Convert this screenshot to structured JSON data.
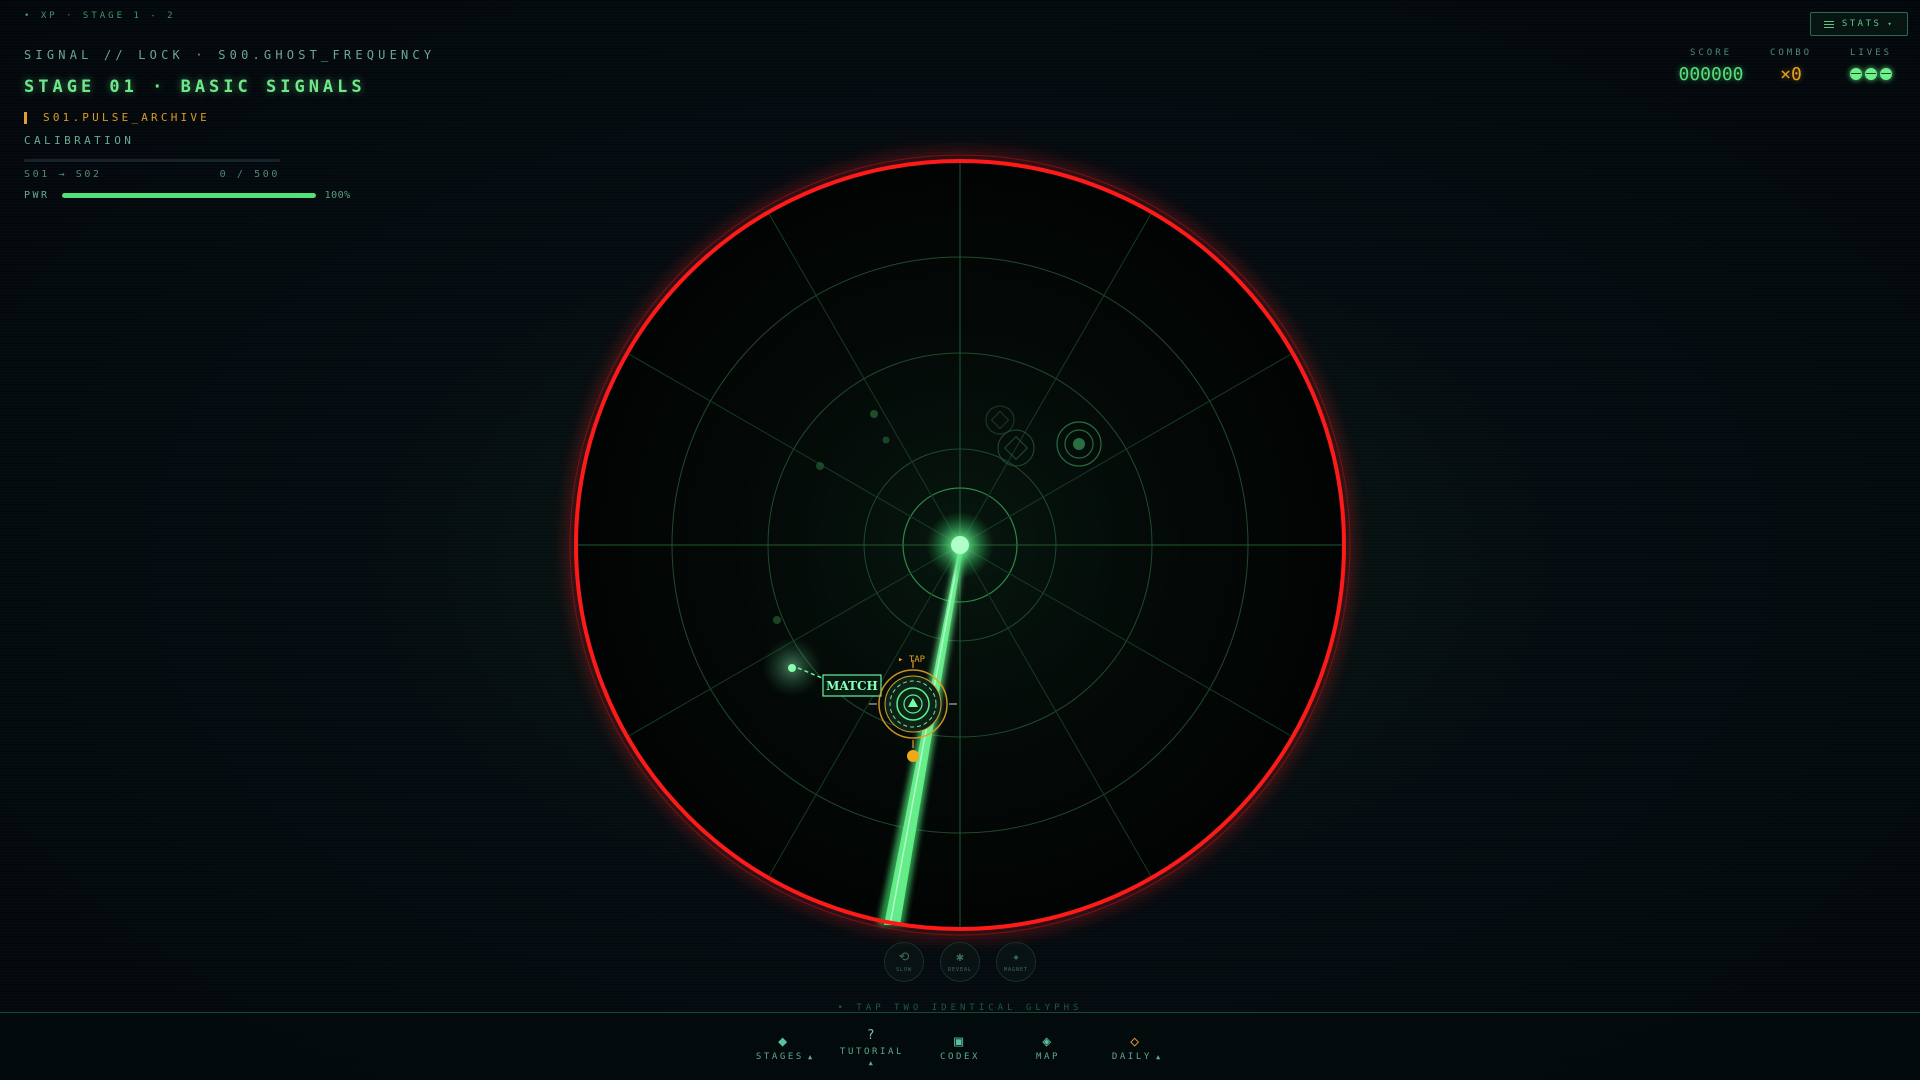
{
  "top_tag": "• XP · STAGE 1 - 2",
  "hud": {
    "signal_line": "SIGNAL // LOCK · S00.GHOST_FREQUENCY",
    "stage_title": "STAGE 01 · BASIC SIGNALS",
    "archive": "S01.PULSE_ARCHIVE",
    "calibration_label": "CALIBRATION",
    "calibration_route": "S01 → S02",
    "calibration_progress": "0 / 500",
    "calibration_fraction": 0.0,
    "pwr_label": "PWR",
    "pwr_percent_text": "100%",
    "pwr_fraction": 1.0
  },
  "stats_button": {
    "label": "STATS",
    "caret": "▾"
  },
  "scoreboard": {
    "score_label": "SCORE",
    "score_value": "000000",
    "combo_label": "COMBO",
    "combo_value": "×0",
    "lives_label": "LIVES",
    "lives_count": 3
  },
  "radar": {
    "match_label": "MATCH",
    "tap_label": "▸ TAP",
    "ring_color": "#ff1a1a",
    "beam_color": "#54e078",
    "target_color": "#e0a020"
  },
  "powerups": [
    {
      "icon": "slow-icon",
      "glyph": "⟲",
      "label": "SLOW"
    },
    {
      "icon": "reveal-icon",
      "glyph": "✱",
      "label": "REVEAL"
    },
    {
      "icon": "magnet-icon",
      "glyph": "✦",
      "label": "MAGNET"
    }
  ],
  "hint": "• TAP TWO IDENTICAL GLYPHS",
  "nav": {
    "stages": {
      "icon": "diamond-icon",
      "glyph": "◆",
      "label": "STAGES",
      "arrow": "▲"
    },
    "tutorial": {
      "icon": "question-icon",
      "glyph": "?",
      "label": "TUTORIAL",
      "arrow": "▲"
    },
    "codex": {
      "icon": "codex-icon",
      "glyph": "▣",
      "label": "CODEX"
    },
    "map": {
      "icon": "map-icon",
      "glyph": "◈",
      "label": "MAP"
    },
    "daily": {
      "icon": "daily-diamond-icon",
      "glyph": "◇",
      "label": "DAILY",
      "arrow": "▲"
    }
  }
}
